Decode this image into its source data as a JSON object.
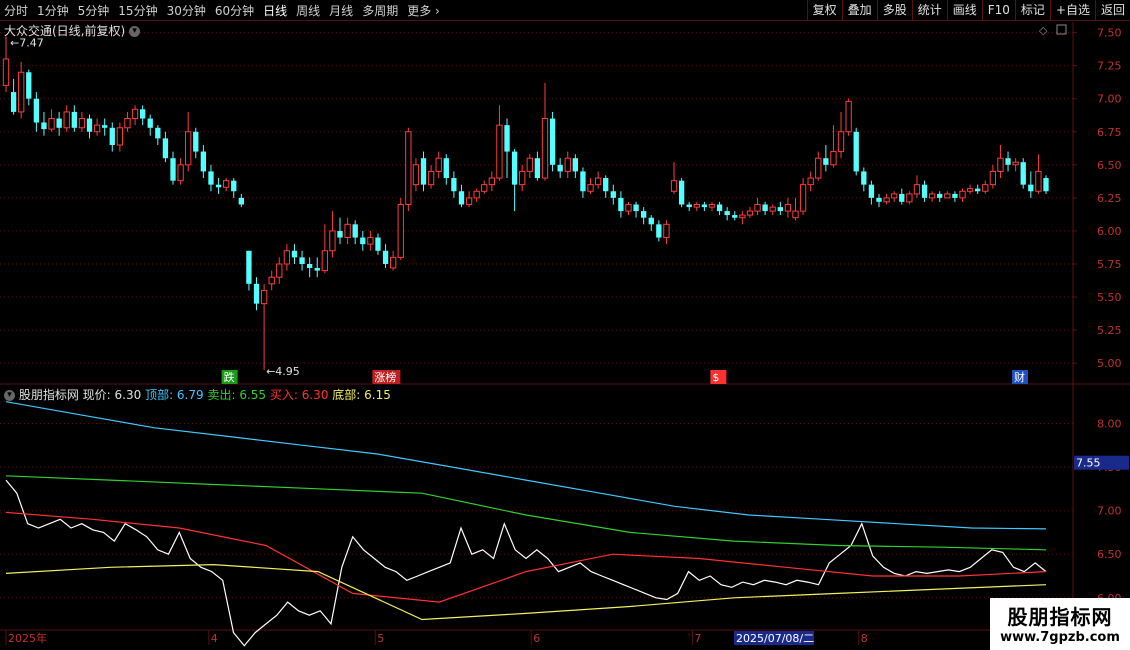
{
  "toolbar": {
    "periods": [
      "分时",
      "1分钟",
      "5分钟",
      "15分钟",
      "30分钟",
      "60分钟",
      "日线",
      "周线",
      "月线",
      "多周期",
      "更多"
    ],
    "active_period": "日线",
    "actions": [
      "复权",
      "叠加",
      "多股",
      "统计",
      "画线",
      "F10",
      "标记",
      "+自选",
      "返回"
    ]
  },
  "main_chart": {
    "title": "大众交通(日线,前复权)",
    "max_label": "7.47",
    "min_label": "4.95",
    "y_ticks": [
      "7.50",
      "7.25",
      "7.00",
      "6.75",
      "6.50",
      "6.25",
      "6.00",
      "5.75",
      "5.50",
      "5.25",
      "5.00"
    ],
    "markers": [
      {
        "text": "跌",
        "color": "#1a9c1a"
      },
      {
        "text": "涨榜",
        "color": "#c02020"
      },
      {
        "text": "$",
        "color": "#ff3030"
      },
      {
        "text": "财",
        "color": "#2050c0"
      }
    ]
  },
  "indicator": {
    "name": "股朋指标网",
    "items": [
      {
        "label": "现价:",
        "value": "6.30",
        "color": "#e0e0e0"
      },
      {
        "label": "顶部:",
        "value": "6.79",
        "color": "#40c8ff"
      },
      {
        "label": "卖出:",
        "value": "6.55",
        "color": "#30d030"
      },
      {
        "label": "买入:",
        "value": "6.30",
        "color": "#ff3030"
      },
      {
        "label": "底部:",
        "value": "6.15",
        "color": "#f0f060"
      }
    ],
    "y_ticks": [
      "8.00",
      "7.50",
      "7.00",
      "6.50",
      "6.00"
    ],
    "current_value": "7.55"
  },
  "x_axis": {
    "labels": [
      "2025年",
      "4",
      "5",
      "6",
      "7",
      "8"
    ],
    "cursor_date": "2025/07/08/二"
  },
  "watermark": {
    "line1": "股朋指标网",
    "line2": "www.7gpzb.com"
  },
  "colors": {
    "up": "#ff3c3c",
    "down": "#54ffff",
    "grid": "#5a1010",
    "top": "#40c8ff",
    "sell": "#30d030",
    "buy": "#ff3030",
    "bottom": "#f0f060",
    "price": "#ffffff"
  },
  "chart_data": {
    "type": "candlestick",
    "ylim": [
      4.85,
      7.58
    ],
    "candles": [
      [
        7.1,
        7.3,
        7.47,
        7.05
      ],
      [
        7.05,
        6.9,
        7.15,
        6.88
      ],
      [
        6.9,
        7.2,
        7.28,
        6.85
      ],
      [
        7.2,
        7.0,
        7.22,
        6.95
      ],
      [
        7.0,
        6.82,
        7.05,
        6.75
      ],
      [
        6.82,
        6.77,
        6.9,
        6.72
      ],
      [
        6.77,
        6.85,
        6.92,
        6.75
      ],
      [
        6.85,
        6.78,
        6.9,
        6.72
      ],
      [
        6.78,
        6.9,
        6.95,
        6.75
      ],
      [
        6.9,
        6.78,
        6.95,
        6.75
      ],
      [
        6.78,
        6.85,
        6.9,
        6.75
      ],
      [
        6.85,
        6.75,
        6.88,
        6.7
      ],
      [
        6.75,
        6.8,
        6.85,
        6.72
      ],
      [
        6.8,
        6.78,
        6.85,
        6.72
      ],
      [
        6.78,
        6.65,
        6.82,
        6.6
      ],
      [
        6.65,
        6.78,
        6.82,
        6.6
      ],
      [
        6.78,
        6.85,
        6.9,
        6.75
      ],
      [
        6.85,
        6.92,
        6.95,
        6.8
      ],
      [
        6.92,
        6.85,
        6.95,
        6.8
      ],
      [
        6.85,
        6.78,
        6.88,
        6.72
      ],
      [
        6.78,
        6.7,
        6.8,
        6.65
      ],
      [
        6.7,
        6.55,
        6.75,
        6.52
      ],
      [
        6.55,
        6.38,
        6.6,
        6.35
      ],
      [
        6.38,
        6.5,
        6.55,
        6.35
      ],
      [
        6.5,
        6.75,
        6.9,
        6.45
      ],
      [
        6.75,
        6.6,
        6.78,
        6.55
      ],
      [
        6.6,
        6.45,
        6.65,
        6.4
      ],
      [
        6.45,
        6.35,
        6.5,
        6.3
      ],
      [
        6.35,
        6.33,
        6.4,
        6.28
      ],
      [
        6.33,
        6.38,
        6.4,
        6.3
      ],
      [
        6.38,
        6.3,
        6.4,
        6.25
      ],
      [
        6.25,
        6.2,
        6.28,
        6.18
      ],
      [
        5.85,
        5.6,
        5.85,
        5.55
      ],
      [
        5.6,
        5.45,
        5.65,
        5.4
      ],
      [
        5.45,
        5.55,
        5.6,
        4.95
      ],
      [
        5.6,
        5.65,
        5.7,
        5.55
      ],
      [
        5.65,
        5.75,
        5.8,
        5.6
      ],
      [
        5.75,
        5.85,
        5.9,
        5.7
      ],
      [
        5.85,
        5.8,
        5.9,
        5.75
      ],
      [
        5.8,
        5.75,
        5.85,
        5.7
      ],
      [
        5.75,
        5.72,
        5.8,
        5.65
      ],
      [
        5.72,
        5.7,
        5.8,
        5.65
      ],
      [
        5.7,
        5.85,
        6.05,
        5.68
      ],
      [
        5.85,
        6.0,
        6.15,
        5.8
      ],
      [
        6.0,
        5.95,
        6.1,
        5.9
      ],
      [
        5.95,
        6.05,
        6.1,
        5.9
      ],
      [
        6.05,
        5.95,
        6.08,
        5.9
      ],
      [
        5.95,
        5.9,
        6.0,
        5.85
      ],
      [
        5.9,
        5.95,
        6.0,
        5.85
      ],
      [
        5.95,
        5.85,
        5.98,
        5.82
      ],
      [
        5.85,
        5.75,
        5.9,
        5.72
      ],
      [
        5.72,
        5.8,
        5.85,
        5.7
      ],
      [
        5.8,
        6.2,
        6.25,
        5.78
      ],
      [
        6.2,
        6.75,
        6.78,
        6.15
      ],
      [
        6.35,
        6.5,
        6.55,
        6.3
      ],
      [
        6.55,
        6.35,
        6.6,
        6.3
      ],
      [
        6.35,
        6.45,
        6.5,
        6.32
      ],
      [
        6.45,
        6.55,
        6.6,
        6.4
      ],
      [
        6.55,
        6.4,
        6.58,
        6.35
      ],
      [
        6.4,
        6.3,
        6.45,
        6.25
      ],
      [
        6.3,
        6.2,
        6.35,
        6.18
      ],
      [
        6.2,
        6.25,
        6.3,
        6.18
      ],
      [
        6.25,
        6.3,
        6.32,
        6.22
      ],
      [
        6.3,
        6.35,
        6.38,
        6.28
      ],
      [
        6.35,
        6.4,
        6.45,
        6.3
      ],
      [
        6.4,
        6.8,
        6.95,
        6.38
      ],
      [
        6.8,
        6.6,
        6.85,
        6.4
      ],
      [
        6.6,
        6.35,
        6.62,
        6.15
      ],
      [
        6.35,
        6.45,
        6.5,
        6.3
      ],
      [
        6.45,
        6.55,
        6.58,
        6.4
      ],
      [
        6.55,
        6.4,
        6.6,
        6.38
      ],
      [
        6.4,
        6.85,
        7.12,
        6.38
      ],
      [
        6.85,
        6.5,
        6.9,
        6.45
      ],
      [
        6.5,
        6.45,
        6.55,
        6.4
      ],
      [
        6.45,
        6.55,
        6.6,
        6.4
      ],
      [
        6.55,
        6.45,
        6.58,
        6.4
      ],
      [
        6.45,
        6.3,
        6.48,
        6.25
      ],
      [
        6.3,
        6.35,
        6.4,
        6.28
      ],
      [
        6.35,
        6.4,
        6.45,
        6.32
      ],
      [
        6.4,
        6.3,
        6.42,
        6.25
      ],
      [
        6.3,
        6.25,
        6.35,
        6.2
      ],
      [
        6.25,
        6.15,
        6.3,
        6.1
      ],
      [
        6.15,
        6.2,
        6.22,
        6.12
      ],
      [
        6.2,
        6.15,
        6.22,
        6.1
      ],
      [
        6.15,
        6.1,
        6.18,
        6.05
      ],
      [
        6.1,
        6.05,
        6.12,
        6.0
      ],
      [
        6.05,
        5.95,
        6.08,
        5.92
      ],
      [
        5.95,
        6.05,
        6.08,
        5.9
      ],
      [
        6.3,
        6.38,
        6.52,
        6.28
      ],
      [
        6.38,
        6.2,
        6.4,
        6.18
      ],
      [
        6.2,
        6.18,
        6.22,
        6.15
      ],
      [
        6.18,
        6.2,
        6.22,
        6.15
      ],
      [
        6.2,
        6.18,
        6.22,
        6.15
      ],
      [
        6.18,
        6.2,
        6.22,
        6.15
      ],
      [
        6.2,
        6.15,
        6.22,
        6.12
      ],
      [
        6.15,
        6.12,
        6.18,
        6.08
      ],
      [
        6.12,
        6.1,
        6.15,
        6.08
      ],
      [
        6.1,
        6.12,
        6.15,
        6.05
      ],
      [
        6.12,
        6.15,
        6.18,
        6.1
      ],
      [
        6.15,
        6.2,
        6.25,
        6.12
      ],
      [
        6.2,
        6.15,
        6.22,
        6.12
      ],
      [
        6.15,
        6.18,
        6.2,
        6.12
      ],
      [
        6.18,
        6.15,
        6.22,
        6.12
      ],
      [
        6.15,
        6.2,
        6.25,
        6.1
      ],
      [
        6.1,
        6.15,
        6.25,
        6.08
      ],
      [
        6.15,
        6.35,
        6.4,
        6.12
      ],
      [
        6.35,
        6.4,
        6.45,
        6.3
      ],
      [
        6.4,
        6.55,
        6.6,
        6.38
      ],
      [
        6.55,
        6.5,
        6.65,
        6.45
      ],
      [
        6.5,
        6.6,
        6.8,
        6.48
      ],
      [
        6.6,
        6.75,
        6.9,
        6.55
      ],
      [
        6.75,
        6.98,
        7.0,
        6.72
      ],
      [
        6.75,
        6.45,
        6.78,
        6.42
      ],
      [
        6.45,
        6.35,
        6.48,
        6.3
      ],
      [
        6.35,
        6.25,
        6.38,
        6.2
      ],
      [
        6.25,
        6.22,
        6.28,
        6.18
      ],
      [
        6.22,
        6.25,
        6.28,
        6.2
      ],
      [
        6.25,
        6.28,
        6.3,
        6.22
      ],
      [
        6.28,
        6.22,
        6.32,
        6.2
      ],
      [
        6.22,
        6.28,
        6.3,
        6.2
      ],
      [
        6.28,
        6.35,
        6.42,
        6.25
      ],
      [
        6.35,
        6.25,
        6.38,
        6.22
      ],
      [
        6.25,
        6.28,
        6.3,
        6.22
      ],
      [
        6.28,
        6.25,
        6.3,
        6.22
      ],
      [
        6.25,
        6.28,
        6.3,
        6.25
      ],
      [
        6.28,
        6.25,
        6.3,
        6.22
      ],
      [
        6.25,
        6.3,
        6.32,
        6.22
      ],
      [
        6.3,
        6.32,
        6.35,
        6.28
      ],
      [
        6.32,
        6.3,
        6.35,
        6.28
      ],
      [
        6.3,
        6.35,
        6.38,
        6.28
      ],
      [
        6.35,
        6.45,
        6.5,
        6.32
      ],
      [
        6.45,
        6.55,
        6.65,
        6.4
      ],
      [
        6.55,
        6.5,
        6.6,
        6.45
      ],
      [
        6.5,
        6.52,
        6.55,
        6.45
      ],
      [
        6.52,
        6.35,
        6.55,
        6.32
      ],
      [
        6.35,
        6.3,
        6.45,
        6.25
      ],
      [
        6.3,
        6.45,
        6.58,
        6.28
      ],
      [
        6.4,
        6.3,
        6.42,
        6.28
      ]
    ],
    "indicator_ylim": [
      5.63,
      8.43
    ],
    "indicator_series": [
      {
        "name": "现价",
        "values": [
          7.35,
          7.2,
          6.85,
          6.8,
          6.85,
          6.9,
          6.8,
          6.85,
          6.78,
          6.75,
          6.65,
          6.85,
          6.78,
          6.7,
          6.55,
          6.5,
          6.75,
          6.45,
          6.35,
          6.3,
          6.2,
          5.6,
          5.45,
          5.6,
          5.7,
          5.8,
          5.95,
          5.85,
          5.8,
          5.85,
          5.7,
          6.35,
          6.7,
          6.55,
          6.45,
          6.35,
          6.3,
          6.2,
          6.25,
          6.3,
          6.35,
          6.4,
          6.8,
          6.5,
          6.55,
          6.45,
          6.85,
          6.55,
          6.45,
          6.55,
          6.45,
          6.3,
          6.35,
          6.4,
          6.3,
          6.25,
          6.2,
          6.15,
          6.1,
          6.05,
          6.0,
          5.98,
          6.05,
          6.3,
          6.2,
          6.25,
          6.15,
          6.12,
          6.18,
          6.15,
          6.2,
          6.18,
          6.15,
          6.2,
          6.18,
          6.15,
          6.4,
          6.5,
          6.6,
          6.85,
          6.48,
          6.35,
          6.28,
          6.25,
          6.3,
          6.28,
          6.3,
          6.32,
          6.3,
          6.35,
          6.45,
          6.55,
          6.52,
          6.35,
          6.3,
          6.4,
          6.3
        ]
      },
      {
        "name": "顶部",
        "values": [
          8.25,
          8.1,
          7.95,
          7.85,
          7.75,
          7.65,
          7.5,
          7.35,
          7.2,
          7.05,
          6.95,
          6.9,
          6.85,
          6.8,
          6.79
        ]
      },
      {
        "name": "卖出",
        "values": [
          7.4,
          7.35,
          7.3,
          7.25,
          7.2,
          6.95,
          6.75,
          6.65,
          6.6,
          6.58,
          6.55
        ]
      },
      {
        "name": "买入",
        "values": [
          6.98,
          6.9,
          6.8,
          6.6,
          6.05,
          5.95,
          6.3,
          6.5,
          6.45,
          6.35,
          6.25,
          6.25,
          6.3
        ]
      },
      {
        "name": "底部",
        "values": [
          6.28,
          6.35,
          6.38,
          6.3,
          5.75,
          5.82,
          5.9,
          6.0,
          6.05,
          6.1,
          6.15
        ]
      }
    ]
  }
}
